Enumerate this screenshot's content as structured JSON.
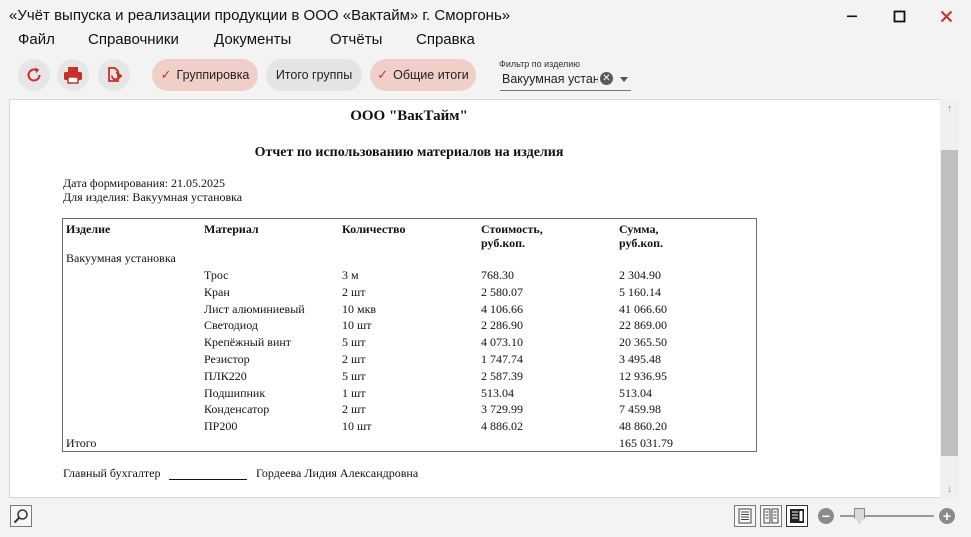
{
  "window": {
    "title": "«Учёт выпуска и реализации продукции в ООО «Вактайм» г. Сморгонь»"
  },
  "menu": [
    "Файл",
    "Справочники",
    "Документы",
    "Отчёты",
    "Справка"
  ],
  "toolbar": {
    "icons": [
      "refresh-icon",
      "print-icon",
      "export-icon"
    ],
    "grouping_label": "Группировка",
    "group_totals_label": "Итого группы",
    "grand_totals_label": "Общие итоги",
    "grouping_active": true,
    "group_totals_active": false,
    "grand_totals_active": true
  },
  "filter": {
    "label": "Фильтр по изделию",
    "value": "Вакуумная установка"
  },
  "report": {
    "company": "ООО \"ВакТайм\"",
    "title": "Отчет по использованию материалов на изделия",
    "date_line": "Дата формирования: 21.05.2025",
    "product_line": "Для изделия: Вакуумная установка",
    "columns": [
      {
        "line1": "Изделие",
        "line2": ""
      },
      {
        "line1": "Материал",
        "line2": ""
      },
      {
        "line1": "Количество",
        "line2": ""
      },
      {
        "line1": "Стоимость,",
        "line2": "руб.коп."
      },
      {
        "line1": "Сумма,",
        "line2": "руб.коп."
      }
    ],
    "group_name": "Вакуумная установка",
    "rows": [
      {
        "material": "Трос",
        "qty": "3 м",
        "price": "768.30",
        "sum": "2 304.90"
      },
      {
        "material": "Кран",
        "qty": "2 шт",
        "price": "2 580.07",
        "sum": "5 160.14"
      },
      {
        "material": "Лист алюминиевый",
        "qty": "10 мкв",
        "price": "4 106.66",
        "sum": "41 066.60"
      },
      {
        "material": "Светодиод",
        "qty": "10 шт",
        "price": "2 286.90",
        "sum": "22 869.00"
      },
      {
        "material": "Крепёжный винт",
        "qty": "5 шт",
        "price": "4 073.10",
        "sum": "20 365.50"
      },
      {
        "material": "Резистор",
        "qty": "2 шт",
        "price": "1 747.74",
        "sum": "3 495.48"
      },
      {
        "material": "ПЛК220",
        "qty": "5 шт",
        "price": "2 587.39",
        "sum": "12 936.95"
      },
      {
        "material": "Подшипник",
        "qty": "1 шт",
        "price": "513.04",
        "sum": "513.04"
      },
      {
        "material": "Конденсатор",
        "qty": "2 шт",
        "price": "3 729.99",
        "sum": "7 459.98"
      },
      {
        "material": "ПР200",
        "qty": "10 шт",
        "price": "4 886.02",
        "sum": "48 860.20"
      }
    ],
    "total_label": "Итого",
    "total_sum": "165 031.79",
    "signer_role": "Главный бухгалтер",
    "signer_name": "Гордеева Лидия Александровна"
  },
  "status": {
    "icons": [
      "search-icon",
      "single-page-icon",
      "two-page-icon",
      "page-width-icon",
      "zoom-out-icon",
      "zoom-in-icon"
    ]
  },
  "colors": {
    "accent": "#c9302c",
    "pill_on": "#f1cfc9",
    "pill_off": "#e4e4e4"
  }
}
